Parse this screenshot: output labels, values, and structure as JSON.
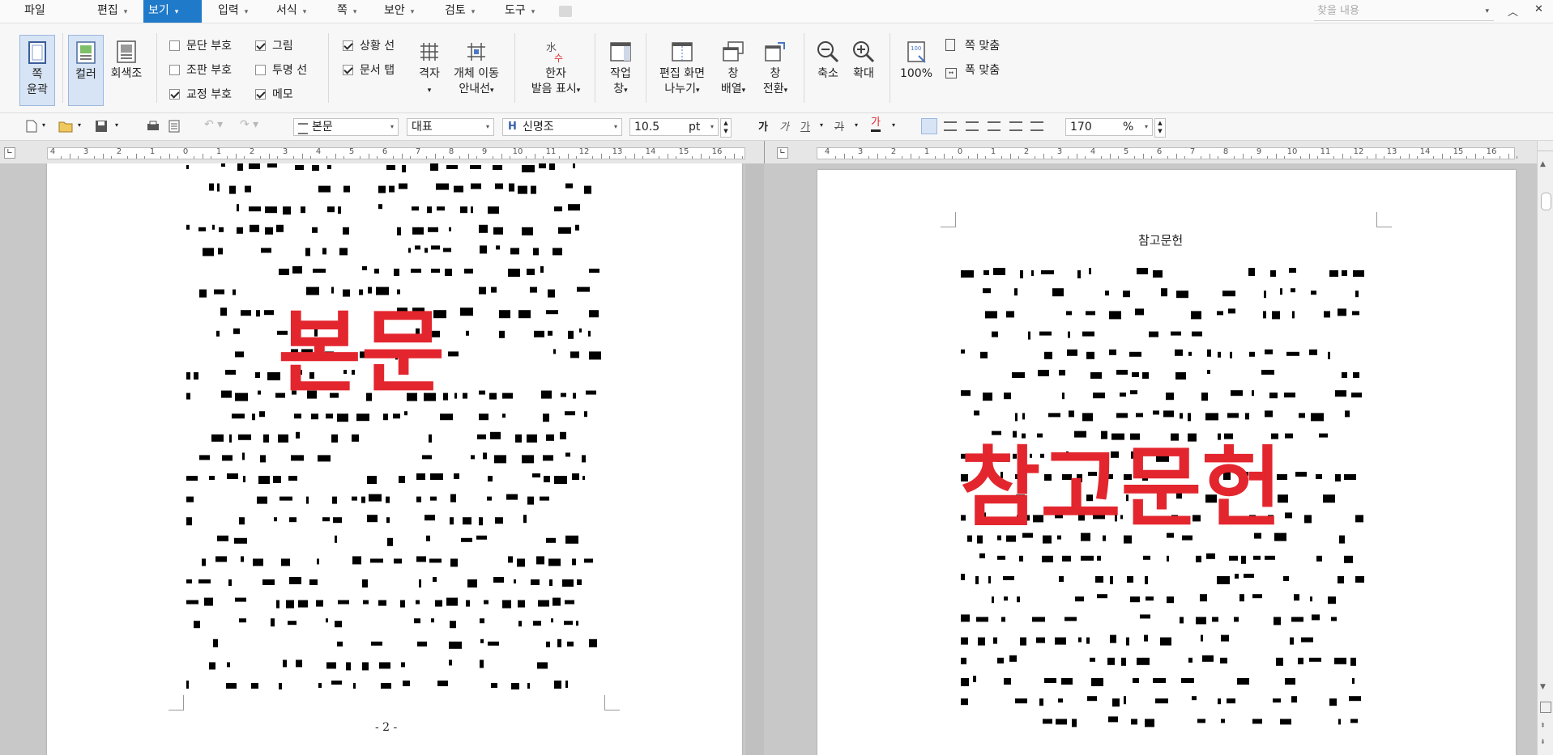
{
  "menubar": {
    "items": [
      {
        "label": "파일",
        "has_caret": false,
        "active": false
      },
      {
        "label": "편집",
        "has_caret": true,
        "active": false
      },
      {
        "label": "보기",
        "has_caret": true,
        "active": true
      },
      {
        "label": "입력",
        "has_caret": true,
        "active": false
      },
      {
        "label": "서식",
        "has_caret": true,
        "active": false
      },
      {
        "label": "쪽",
        "has_caret": true,
        "active": false
      },
      {
        "label": "보안",
        "has_caret": true,
        "active": false
      },
      {
        "label": "검토",
        "has_caret": true,
        "active": false
      },
      {
        "label": "도구",
        "has_caret": true,
        "active": false
      }
    ],
    "search_placeholder": "찾을 내용",
    "accent_color": "#1f7ac9"
  },
  "ribbon": {
    "page_outline": {
      "line1": "쪽",
      "line2": "윤곽"
    },
    "color": "컬러",
    "grayscale": "회색조",
    "checkboxes_col1": [
      {
        "label": "문단 부호",
        "checked": false
      },
      {
        "label": "조판 부호",
        "checked": false
      },
      {
        "label": "교정 부호",
        "checked": true
      }
    ],
    "checkboxes_col2": [
      {
        "label": "그림",
        "checked": true
      },
      {
        "label": "투명 선",
        "checked": false
      },
      {
        "label": "메모",
        "checked": true
      }
    ],
    "checkboxes_col3": [
      {
        "label": "상황 선",
        "checked": true
      },
      {
        "label": "문서 탭",
        "checked": true
      }
    ],
    "grid": "격자",
    "object_move": {
      "line1": "개체 이동",
      "line2": "안내선"
    },
    "hanja": {
      "line1": "한자",
      "line2": "발음 표시"
    },
    "task_window": {
      "line1": "작업",
      "line2": "창"
    },
    "split_view": {
      "line1": "편집 화면",
      "line2": "나누기"
    },
    "arrange_window": {
      "line1": "창",
      "line2": "배열"
    },
    "switch_window": {
      "line1": "창",
      "line2": "전환"
    },
    "zoom_out": "축소",
    "zoom_in": "확대",
    "zoom_100": "100%",
    "fit_page": "쪽 맞춤",
    "fit_width": "폭 맞춤"
  },
  "formatbar": {
    "style": "본문",
    "font_group": "대표",
    "font": "신명조",
    "font_size": "10.5",
    "size_unit": "pt",
    "zoom_value": "170",
    "zoom_unit": "%",
    "text_effect_glyphs": [
      "가",
      "가",
      "가",
      "가",
      "가"
    ]
  },
  "ruler_numbers": [
    "4",
    "3",
    "2",
    "1",
    "0",
    "1",
    "2",
    "3",
    "4",
    "5",
    "6",
    "7",
    "8",
    "9",
    "10",
    "11",
    "12",
    "13",
    "14",
    "15",
    "16"
  ],
  "doc": {
    "left_watermark": "본문",
    "left_page_number": "- 2 -",
    "right_header": "참고문헌",
    "right_watermark": "참고문헌",
    "watermark_color": "#e3262e"
  }
}
